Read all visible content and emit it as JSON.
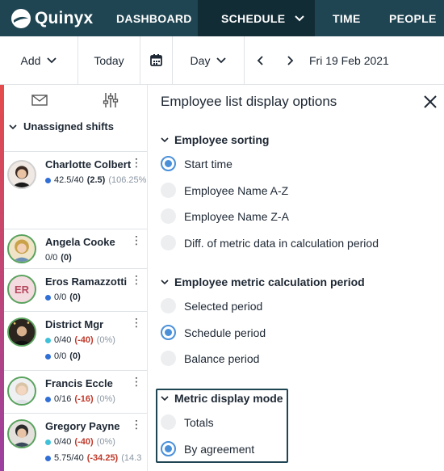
{
  "nav": {
    "logo": "Quinyx",
    "items": [
      "DASHBOARD",
      "SCHEDULE",
      "TIME",
      "PEOPLE"
    ]
  },
  "toolbar": {
    "add": "Add",
    "today": "Today",
    "day": "Day",
    "date": "Fri 19 Feb 2021"
  },
  "list": {
    "unassigned": "Unassigned shifts",
    "employees": [
      {
        "name": "Charlotte Colbert",
        "initials": "",
        "l1_dot": "#2f6fd6",
        "l1_main": "42.5/40",
        "l1_bold": "(2.5)",
        "l1_pct": "(106.25%"
      },
      {
        "name": "Angela Cooke",
        "initials": "",
        "l1_main": "0/0",
        "l1_bold": "(0)"
      },
      {
        "name": "Eros Ramazzotti",
        "initials": "ER",
        "l1_dot": "#2f6fd6",
        "l1_main": "0/0",
        "l1_bold": "(0)"
      },
      {
        "name": "District Mgr",
        "initials": "",
        "l1_dot": "#3fc1d9",
        "l1_main": "0/40",
        "l1_neg": "(-40)",
        "l1_pct": "(0%)",
        "l2_dot": "#2f6fd6",
        "l2_main": "0/0",
        "l2_bold": "(0)"
      },
      {
        "name": "Francis Eccle",
        "initials": "",
        "l1_dot": "#2f6fd6",
        "l1_main": "0/16",
        "l1_neg": "(-16)",
        "l1_pct": "(0%)"
      },
      {
        "name": "Gregory Payne",
        "initials": "",
        "l1_dot": "#3fc1d9",
        "l1_main": "0/40",
        "l1_neg": "(-40)",
        "l1_pct": "(0%)",
        "l2_dot": "#2f6fd6",
        "l2_main": "5.75/40",
        "l2_neg": "(-34.25)",
        "l2_pct": "(14.3"
      }
    ]
  },
  "panel": {
    "title": "Employee list display options",
    "sections": [
      {
        "heading": "Employee sorting",
        "options": [
          "Start time",
          "Employee Name A-Z",
          "Employee Name Z-A",
          "Diff. of metric data in calculation period"
        ],
        "selected": 0
      },
      {
        "heading": "Employee metric calculation period",
        "options": [
          "Selected period",
          "Schedule period",
          "Balance period"
        ],
        "selected": 1
      },
      {
        "heading": "Metric display mode",
        "options": [
          "Totals",
          "By agreement"
        ],
        "selected": 1
      }
    ]
  },
  "colors": {
    "nav_bg": "#1f4452",
    "nav_active": "#122c36",
    "accent": "#4a90d9",
    "negative": "#c0392b"
  }
}
